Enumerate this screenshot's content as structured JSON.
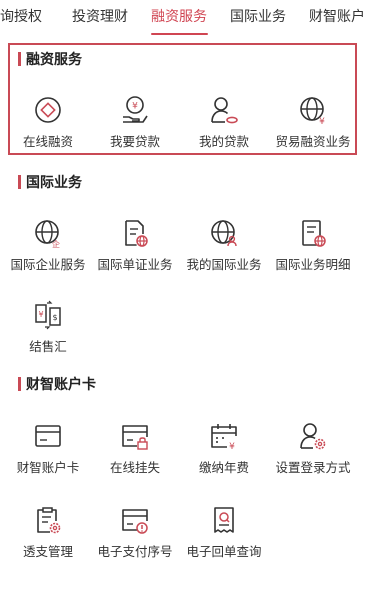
{
  "tabs": [
    {
      "label": "查询授权"
    },
    {
      "label": "投资理财"
    },
    {
      "label": "融资服务"
    },
    {
      "label": "国际业务"
    },
    {
      "label": "财智账户"
    }
  ],
  "active_tab": "融资服务",
  "colors": {
    "accent": "#c94a55",
    "icon": "#333333"
  },
  "sections": {
    "financing": {
      "title": "融资服务",
      "items": [
        {
          "label": "在线融资",
          "icon": "diamond-coin-icon"
        },
        {
          "label": "我要贷款",
          "icon": "hand-yen-icon"
        },
        {
          "label": "我的贷款",
          "icon": "user-loan-icon"
        },
        {
          "label": "贸易融资业务",
          "icon": "globe-yen-icon"
        }
      ]
    },
    "international": {
      "title": "国际业务",
      "items": [
        {
          "label": "国际企业服务",
          "icon": "globe-enterprise-icon"
        },
        {
          "label": "国际单证业务",
          "icon": "document-globe-icon"
        },
        {
          "label": "我的国际业务",
          "icon": "globe-user-icon"
        },
        {
          "label": "国际业务明细",
          "icon": "list-globe-icon"
        },
        {
          "label": "结售汇",
          "icon": "currency-exchange-icon"
        }
      ]
    },
    "account": {
      "title": "财智账户卡",
      "items": [
        {
          "label": "财智账户卡",
          "icon": "card-icon"
        },
        {
          "label": "在线挂失",
          "icon": "card-lock-icon"
        },
        {
          "label": "缴纳年费",
          "icon": "calendar-yen-icon"
        },
        {
          "label": "设置登录方式",
          "icon": "user-gear-icon"
        },
        {
          "label": "透支管理",
          "icon": "clipboard-gear-icon"
        },
        {
          "label": "电子支付序号",
          "icon": "card-alert-icon"
        },
        {
          "label": "电子回单查询",
          "icon": "receipt-search-icon"
        }
      ]
    }
  }
}
